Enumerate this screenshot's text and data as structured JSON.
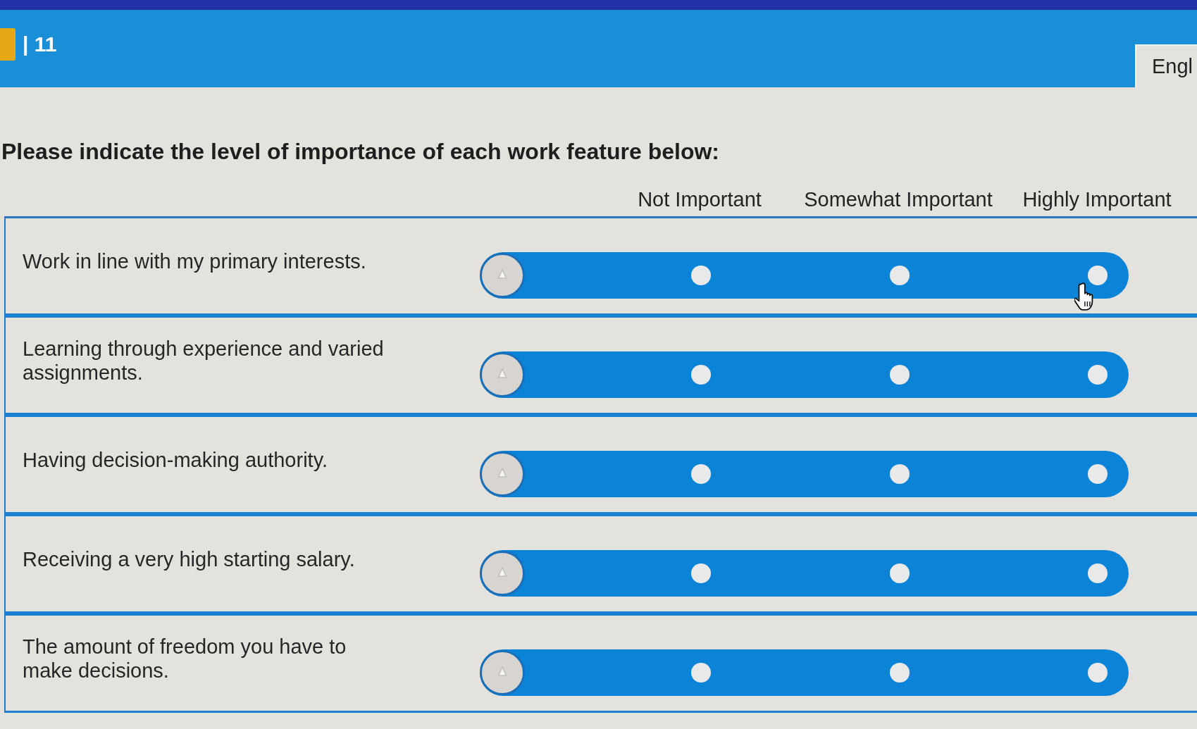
{
  "header": {
    "counter": "| 11",
    "language": "Engl"
  },
  "title": "Please indicate the level of importance of each work feature below:",
  "scale": {
    "columns": [
      "Not Important",
      "Somewhat Important",
      "Highly Important"
    ]
  },
  "rows": [
    {
      "label": "Work in line with my primary interests.",
      "level": 0
    },
    {
      "label": "Learning through experience and varied assignments.",
      "level": 0
    },
    {
      "label": "Having decision-making authority.",
      "level": 0
    },
    {
      "label": "Receiving a very high starting salary.",
      "level": 0
    },
    {
      "label": "The amount of freedom you have to make decisions.",
      "level": 0
    }
  ]
}
